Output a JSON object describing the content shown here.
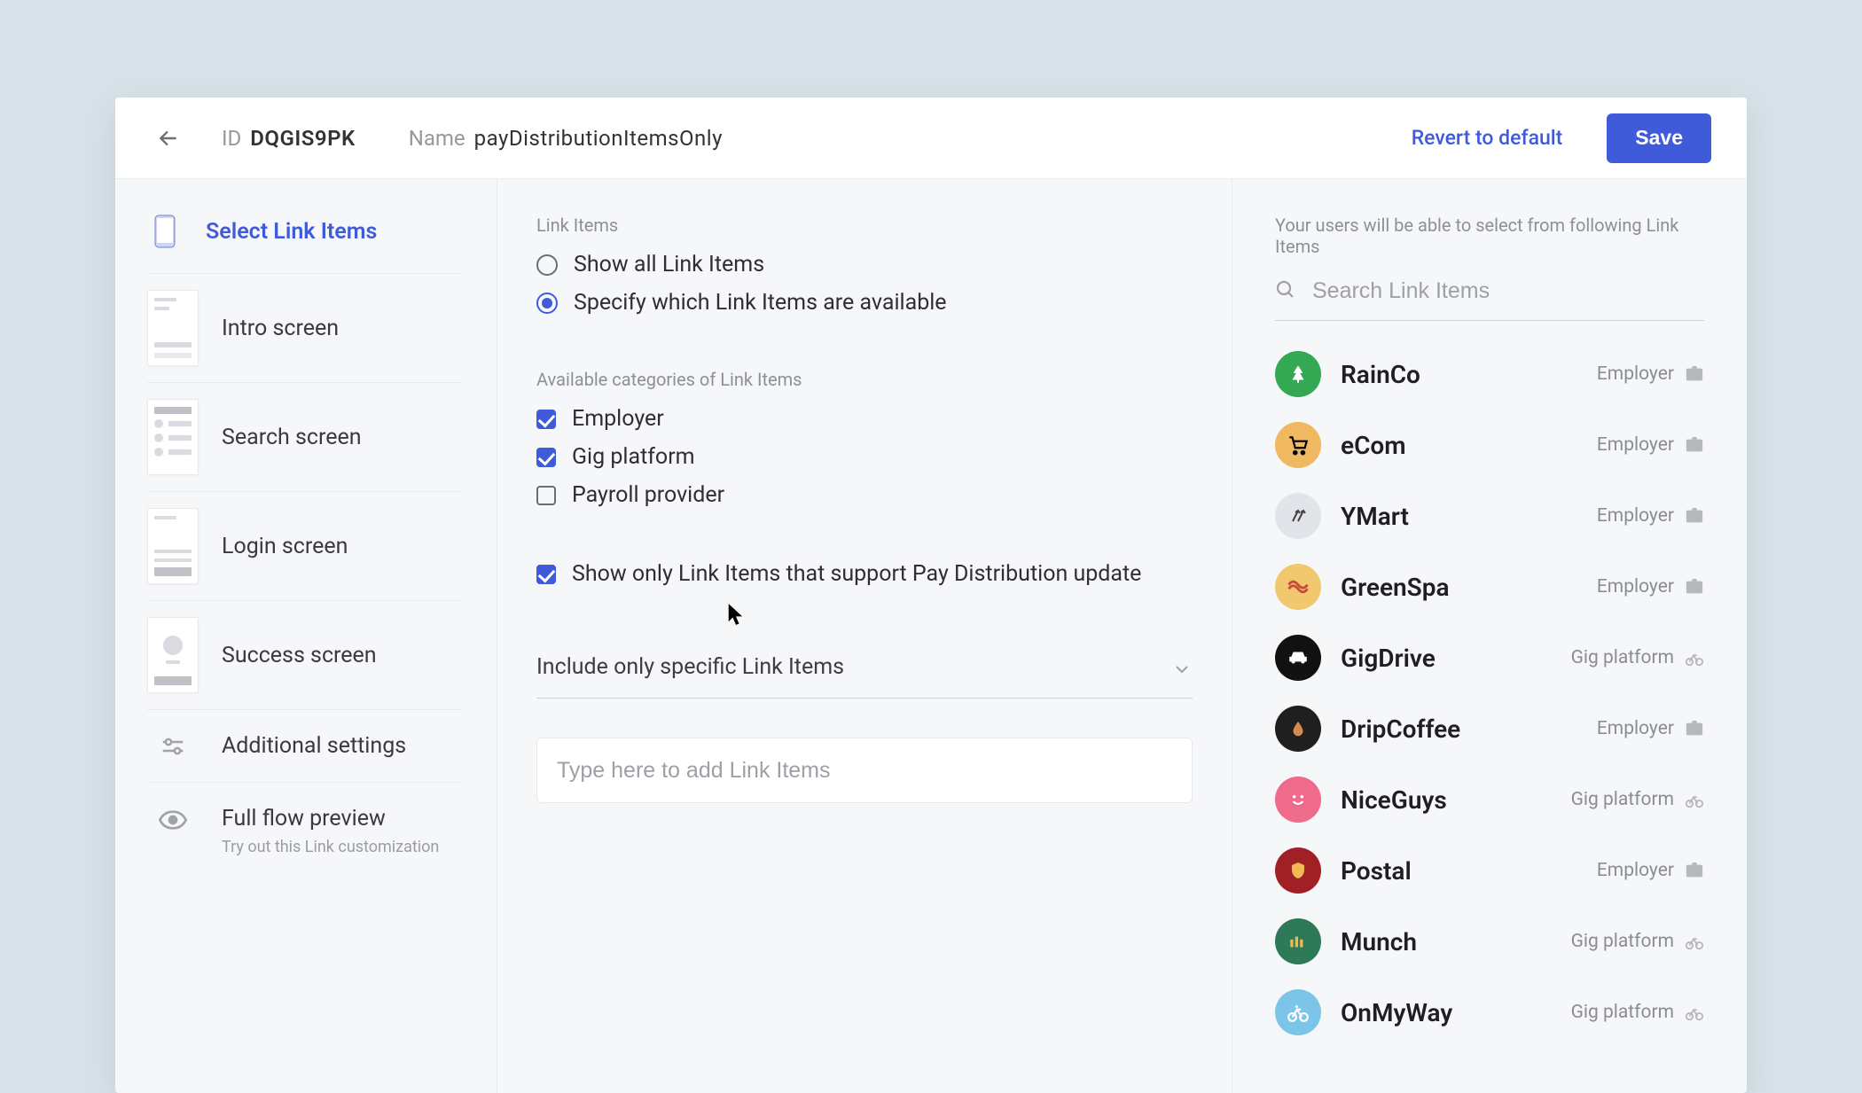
{
  "topbar": {
    "id_label": "ID",
    "id_value": "DQGIS9PK",
    "name_label": "Name",
    "name_value": "payDistributionItemsOnly",
    "revert": "Revert to default",
    "save": "Save"
  },
  "sidebar": {
    "items": [
      {
        "label": "Select Link Items"
      },
      {
        "label": "Intro screen"
      },
      {
        "label": "Search screen"
      },
      {
        "label": "Login screen"
      },
      {
        "label": "Success screen"
      }
    ],
    "additional": "Additional settings",
    "full_flow": "Full flow preview",
    "full_flow_sub": "Try out this Link customization"
  },
  "main": {
    "link_items_label": "Link Items",
    "radio_all": "Show all Link Items",
    "radio_specify": "Specify which Link Items are available",
    "categories_label": "Available categories of Link Items",
    "cat_employer": "Employer",
    "cat_gig": "Gig platform",
    "cat_payroll": "Payroll provider",
    "show_only": "Show only Link Items that support Pay Distribution update",
    "include_only": "Include only specific Link Items",
    "add_placeholder": "Type here to add Link Items"
  },
  "preview": {
    "note": "Your users will be able to select from following Link Items",
    "search_placeholder": "Search Link Items",
    "items": [
      {
        "name": "RainCo",
        "tag": "Employer",
        "color": "#34a853",
        "icon": "tree"
      },
      {
        "name": "eCom",
        "tag": "Employer",
        "color": "#f0b860",
        "icon": "cart"
      },
      {
        "name": "YMart",
        "tag": "Employer",
        "color": "#e2e4e9",
        "icon": "arrows",
        "fg": "#444"
      },
      {
        "name": "GreenSpa",
        "tag": "Employer",
        "color": "#f2c86e",
        "icon": "wave",
        "fg": "#c84a3e"
      },
      {
        "name": "GigDrive",
        "tag": "Gig platform",
        "color": "#111111",
        "icon": "car"
      },
      {
        "name": "DripCoffee",
        "tag": "Employer",
        "color": "#1f1f1f",
        "icon": "drop",
        "fg": "#d68a4f"
      },
      {
        "name": "NiceGuys",
        "tag": "Gig platform",
        "color": "#ef6b8c",
        "icon": "smile"
      },
      {
        "name": "Postal",
        "tag": "Employer",
        "color": "#a02025",
        "icon": "shield",
        "fg": "#f2b851"
      },
      {
        "name": "Munch",
        "tag": "Gig platform",
        "color": "#2e7a58",
        "icon": "stripes",
        "fg": "#f2b851"
      },
      {
        "name": "OnMyWay",
        "tag": "Gig platform",
        "color": "#7bc6e8",
        "icon": "bike"
      }
    ]
  }
}
